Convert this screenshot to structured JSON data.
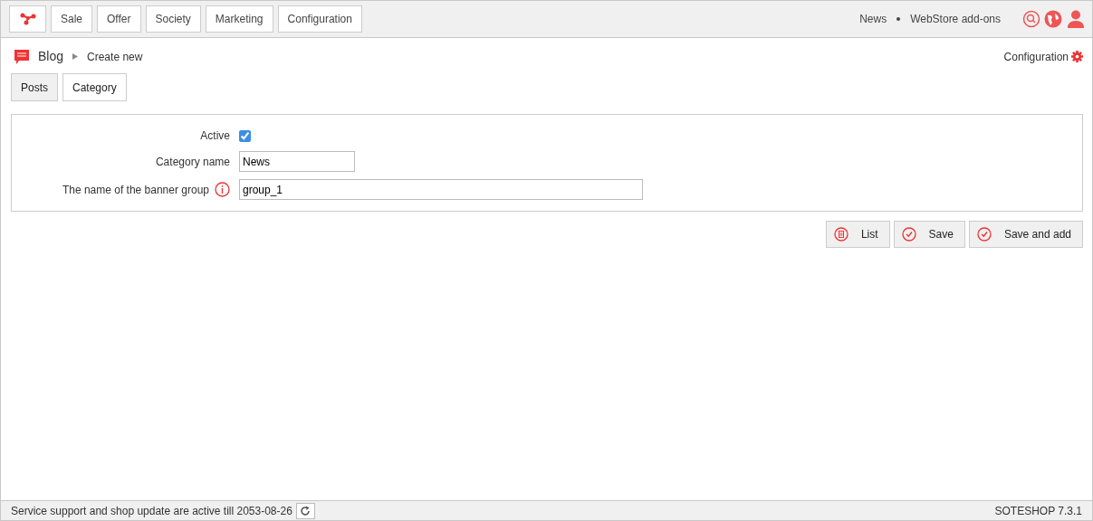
{
  "top_menu": [
    "Sale",
    "Offer",
    "Society",
    "Marketing",
    "Configuration"
  ],
  "top_links": [
    "News",
    "WebStore add-ons"
  ],
  "breadcrumb": {
    "module": "Blog",
    "current": "Create new"
  },
  "config_link": "Configuration",
  "tabs": [
    {
      "label": "Posts",
      "selected": false
    },
    {
      "label": "Category",
      "selected": true
    }
  ],
  "form": {
    "active": {
      "label": "Active",
      "checked": true
    },
    "category_name": {
      "label": "Category name",
      "value": "News"
    },
    "banner_group": {
      "label": "The name of the banner group",
      "value": "group_1"
    }
  },
  "buttons": [
    {
      "label": "List",
      "kind": "list"
    },
    {
      "label": "Save",
      "kind": "check"
    },
    {
      "label": "Save and add",
      "kind": "check"
    }
  ],
  "status_bar": {
    "text": "Service support and shop update are active till 2053-08-26",
    "version": "SOTESHOP 7.3.1"
  }
}
